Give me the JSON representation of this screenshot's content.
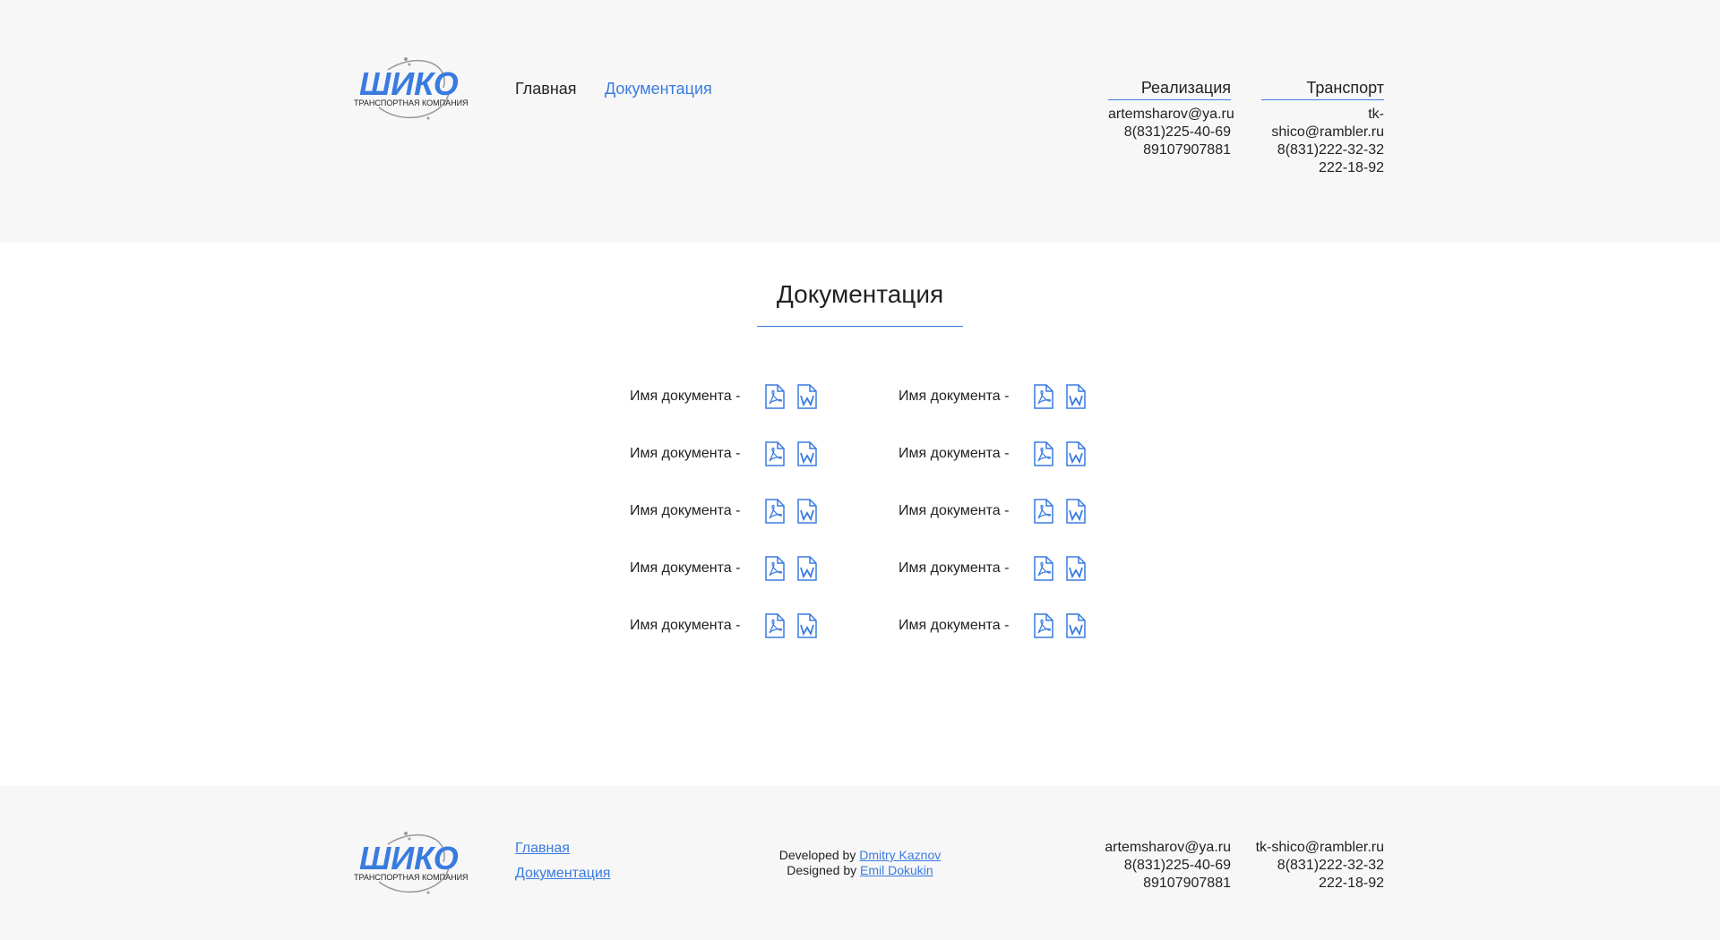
{
  "brand": {
    "name": "ШИКО",
    "tagline": "ТРАНСПОРТНАЯ КОМПАНИЯ",
    "color": "#3a7be0"
  },
  "nav": {
    "home": "Главная",
    "docs": "Документация"
  },
  "contacts": {
    "sales": {
      "title": "Реализация",
      "email": "artemsharov@ya.ru",
      "phone1": "8(831)225-40-69",
      "phone2": "89107907881"
    },
    "transport": {
      "title": "Транспорт",
      "email": "tk-shico@rambler.ru",
      "phone1": "8(831)222-32-32",
      "phone2": "222-18-92"
    }
  },
  "main": {
    "title": "Документация",
    "documents": [
      {
        "name": "Имя документа -",
        "pdf_icon": "pdf-file-icon",
        "word_icon": "word-file-icon"
      },
      {
        "name": "Имя документа -",
        "pdf_icon": "pdf-file-icon",
        "word_icon": "word-file-icon"
      },
      {
        "name": "Имя документа -",
        "pdf_icon": "pdf-file-icon",
        "word_icon": "word-file-icon"
      },
      {
        "name": "Имя документа -",
        "pdf_icon": "pdf-file-icon",
        "word_icon": "word-file-icon"
      },
      {
        "name": "Имя документа -",
        "pdf_icon": "pdf-file-icon",
        "word_icon": "word-file-icon"
      },
      {
        "name": "Имя документа -",
        "pdf_icon": "pdf-file-icon",
        "word_icon": "word-file-icon"
      },
      {
        "name": "Имя документа -",
        "pdf_icon": "pdf-file-icon",
        "word_icon": "word-file-icon"
      },
      {
        "name": "Имя документа -",
        "pdf_icon": "pdf-file-icon",
        "word_icon": "word-file-icon"
      },
      {
        "name": "Имя документа -",
        "pdf_icon": "pdf-file-icon",
        "word_icon": "word-file-icon"
      },
      {
        "name": "Имя документа -",
        "pdf_icon": "pdf-file-icon",
        "word_icon": "word-file-icon"
      }
    ]
  },
  "footer": {
    "links": {
      "home": "Главная",
      "docs": "Документация"
    },
    "credits": {
      "developed_prefix": "Developed by",
      "developer": "Dmitry Kaznov",
      "designed_prefix": "Designed by",
      "designer": "Emil Dokukin"
    }
  }
}
